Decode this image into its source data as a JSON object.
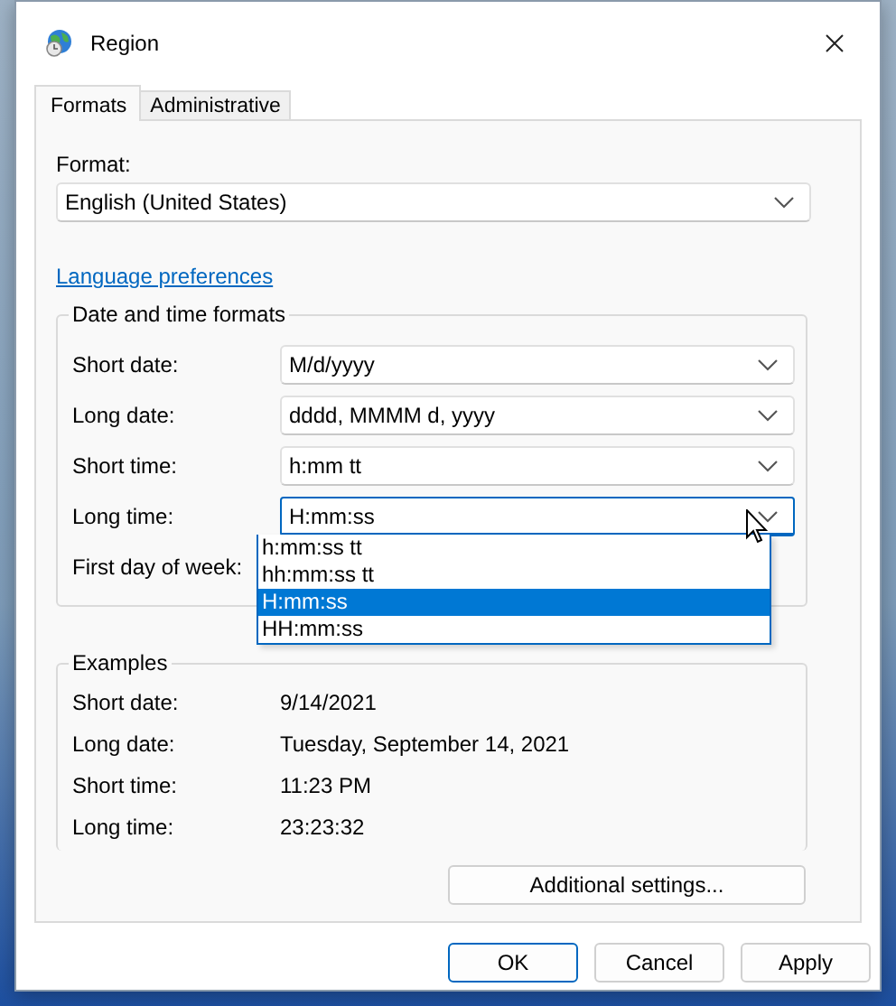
{
  "window": {
    "title": "Region"
  },
  "tabs": [
    {
      "label": "Formats",
      "selected": true
    },
    {
      "label": "Administrative",
      "selected": false
    }
  ],
  "format": {
    "label": "Format:",
    "value": "English (United States)"
  },
  "language_link": "Language preferences",
  "date_time_formats": {
    "title": "Date and time formats",
    "rows": [
      {
        "kind": "combo",
        "label": "Short date:",
        "value": "M/d/yyyy",
        "open": false
      },
      {
        "kind": "combo",
        "label": "Long date:",
        "value": "dddd, MMMM d, yyyy",
        "open": false
      },
      {
        "kind": "combo",
        "label": "Short time:",
        "value": "h:mm tt",
        "open": false
      },
      {
        "kind": "combo",
        "label": "Long time:",
        "value": "H:mm:ss",
        "open": true,
        "options": [
          {
            "label": "h:mm:ss tt",
            "selected": false
          },
          {
            "label": "hh:mm:ss tt",
            "selected": false
          },
          {
            "label": "H:mm:ss",
            "selected": true
          },
          {
            "label": "HH:mm:ss",
            "selected": false
          }
        ]
      },
      {
        "kind": "label",
        "label": "First day of week:"
      }
    ]
  },
  "examples": {
    "title": "Examples",
    "rows": [
      {
        "label": "Short date:",
        "value": "9/14/2021"
      },
      {
        "label": "Long date:",
        "value": "Tuesday, September 14, 2021"
      },
      {
        "label": "Short time:",
        "value": "11:23 PM"
      },
      {
        "label": "Long time:",
        "value": "23:23:32"
      }
    ]
  },
  "additional_settings": "Additional settings...",
  "buttons": [
    {
      "label": "OK",
      "default": true
    },
    {
      "label": "Cancel",
      "default": false
    },
    {
      "label": "Apply",
      "default": false
    }
  ]
}
